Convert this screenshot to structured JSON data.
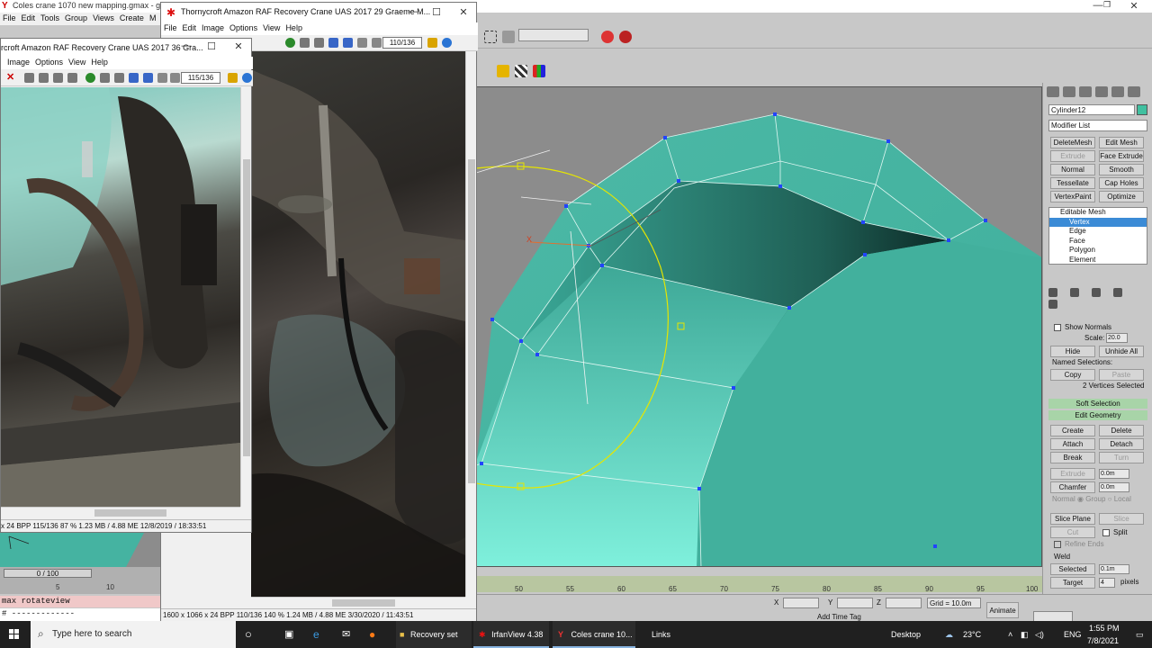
{
  "colors": {
    "mesh": "#45b3a1",
    "mesh_light": "#7fe8d4",
    "gizmo": "#e6e600",
    "selection": "#3b8bd6"
  },
  "gmax": {
    "title": "Coles crane 1070 new mapping.gmax - gmax",
    "menu": [
      "File",
      "Edit",
      "Tools",
      "Group",
      "Views",
      "Create",
      "M"
    ],
    "command_panel": {
      "object_name": "Cylinder12",
      "modifier_list": "Modifier List",
      "modifier_buttons": [
        {
          "label": "DeleteMesh",
          "enabled": true
        },
        {
          "label": "Edit Mesh",
          "enabled": true
        },
        {
          "label": "Extrude",
          "enabled": false
        },
        {
          "label": "Face Extrude",
          "enabled": true
        },
        {
          "label": "Normal",
          "enabled": true
        },
        {
          "label": "Smooth",
          "enabled": true
        },
        {
          "label": "Tessellate",
          "enabled": true
        },
        {
          "label": "Cap Holes",
          "enabled": true
        },
        {
          "label": "VertexPaint",
          "enabled": true
        },
        {
          "label": "Optimize",
          "enabled": true
        }
      ],
      "stack": {
        "root": "Editable Mesh",
        "items": [
          "Vertex",
          "Edge",
          "Face",
          "Polygon",
          "Element"
        ],
        "selected": "Vertex"
      },
      "show_normals": "Show Normals",
      "scale_label": "Scale:",
      "scale_value": "20.0",
      "hide": "Hide",
      "unhide_all": "Unhide All",
      "named_selections": "Named Selections:",
      "copy": "Copy",
      "paste": "Paste",
      "selection_status": "2 Vertices Selected",
      "soft_selection": "Soft Selection",
      "edit_geometry": "Edit Geometry",
      "geom_buttons": [
        {
          "label": "Create",
          "enabled": true
        },
        {
          "label": "Delete",
          "enabled": true
        },
        {
          "label": "Attach",
          "enabled": true
        },
        {
          "label": "Detach",
          "enabled": true
        },
        {
          "label": "Break",
          "enabled": true
        },
        {
          "label": "Turn",
          "enabled": false
        }
      ],
      "extrude": "Extrude",
      "extrude_value": "0.0m",
      "chamfer": "Chamfer",
      "chamfer_value": "0.0m",
      "normal_group_local": "Normal ◉ Group ○ Local",
      "slice_plane": "Slice Plane",
      "slice": "Slice",
      "cut": "Cut",
      "split": "Split",
      "refine_ends": "Refine Ends",
      "weld": "Weld",
      "selected": "Selected",
      "selected_value": "0.1m",
      "target": "Target",
      "target_value": "4",
      "pixels": "pixels"
    },
    "trackbar_ticks": [
      "50",
      "55",
      "60",
      "65",
      "70",
      "75",
      "80",
      "85",
      "90",
      "95",
      "100"
    ],
    "left_trackbar_ticks": [
      "5",
      "10"
    ],
    "frame_slider": "0 / 100",
    "status": {
      "x_label": "X",
      "y_label": "Y",
      "z_label": "Z",
      "grid": "Grid = 10.0m",
      "add_time_tag": "Add Time Tag",
      "animate": "Animate"
    },
    "maxscript_line1": "max rotateview",
    "maxscript_line2": "# -------------"
  },
  "irfanview_back": {
    "title": "Thornycroft Amazon RAF Recovery Crane UAS 2017 29 Graeme M...",
    "menu": [
      "File",
      "Edit",
      "Image",
      "Options",
      "View",
      "Help"
    ],
    "page_box": "110/136",
    "status": "1600 x 1066 x 24 BPP    110/136    140 %    1.24 MB / 4.88 ME 3/30/2020 / 11:43:51"
  },
  "irfanview_front": {
    "title": "rcroft Amazon RAF Recovery Crane UAS 2017 36 Gra...",
    "menu": [
      "Image",
      "Options",
      "View",
      "Help"
    ],
    "page_box": "115/136",
    "status": "x 24 BPP    115/136    87 %    1.23 MB / 4.88 ME 12/8/2019 / 18:33:51"
  },
  "taskbar": {
    "search_placeholder": "Type here to search",
    "apps": [
      {
        "label": "Recovery set",
        "icon": "folder-icon"
      },
      {
        "label": "IrfanView 4.38",
        "icon": "irfanview-icon"
      },
      {
        "label": "Coles crane 10...",
        "icon": "gmax-icon"
      },
      {
        "label": "Links",
        "icon": "folder-icon"
      }
    ],
    "desktop": "Desktop",
    "weather": "23°C",
    "language": "ENG",
    "time": "1:55 PM",
    "date": "7/8/2021"
  }
}
